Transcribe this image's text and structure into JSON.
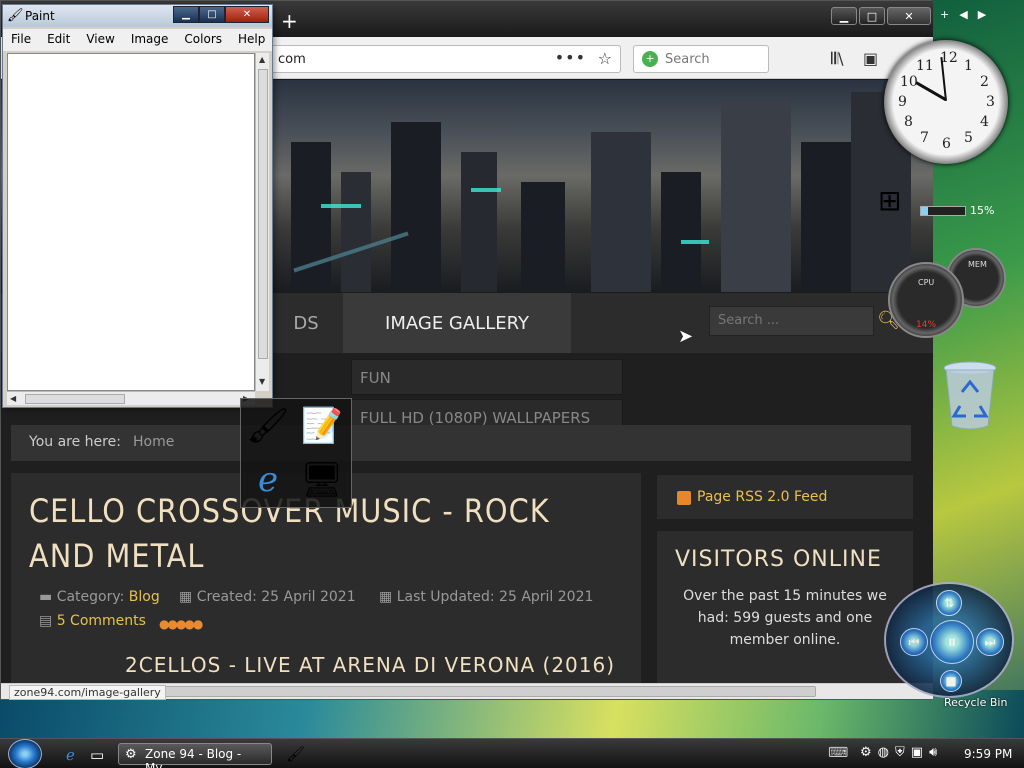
{
  "browser": {
    "url_text": "com",
    "search_placeholder": "Search",
    "status_url": "zone94.com/image-gallery"
  },
  "site": {
    "menu_items": [
      "DS",
      "IMAGE GALLERY"
    ],
    "search_placeholder": "Search ...",
    "submenu_items": [
      "FUN",
      "FULL HD (1080P) WALLPAPERS"
    ],
    "breadcrumb_label": "You are here:",
    "breadcrumb_home": "Home",
    "article": {
      "title": "CELLO CROSSOVER MUSIC - ROCK AND METAL",
      "category_label": "Category:",
      "category": "Blog",
      "created": "Created: 25 April 2021",
      "updated": "Last Updated: 25 April 2021",
      "comments": "5 Comments",
      "subtitle": "2CELLOS - LIVE AT ARENA DI VERONA (2016)"
    },
    "rss_label": "Page RSS 2.0 Feed",
    "visitors": {
      "title": "VISITORS ONLINE",
      "text": "Over the past 15 minutes we had: 599 guests and one member online."
    }
  },
  "paint": {
    "title": "Paint",
    "menu": [
      "File",
      "Edit",
      "View",
      "Image",
      "Colors",
      "Help"
    ]
  },
  "gadgets": {
    "cpu_meter_percent": "15%",
    "cpu_label": "CPU",
    "mem_label": "MEM",
    "cpu_value": "14%",
    "recycle_label": "Recycle Bin"
  },
  "taskbar": {
    "task_label": "Zone 94 - Blog - My...",
    "time": "9:59 PM"
  },
  "clock": {
    "numbers": [
      "12",
      "1",
      "2",
      "3",
      "4",
      "5",
      "6",
      "7",
      "8",
      "9",
      "10",
      "11"
    ]
  },
  "colors": {
    "accent": "#e8c050",
    "title": "#f0e0c0",
    "page_bg": "#1f1f1f"
  }
}
